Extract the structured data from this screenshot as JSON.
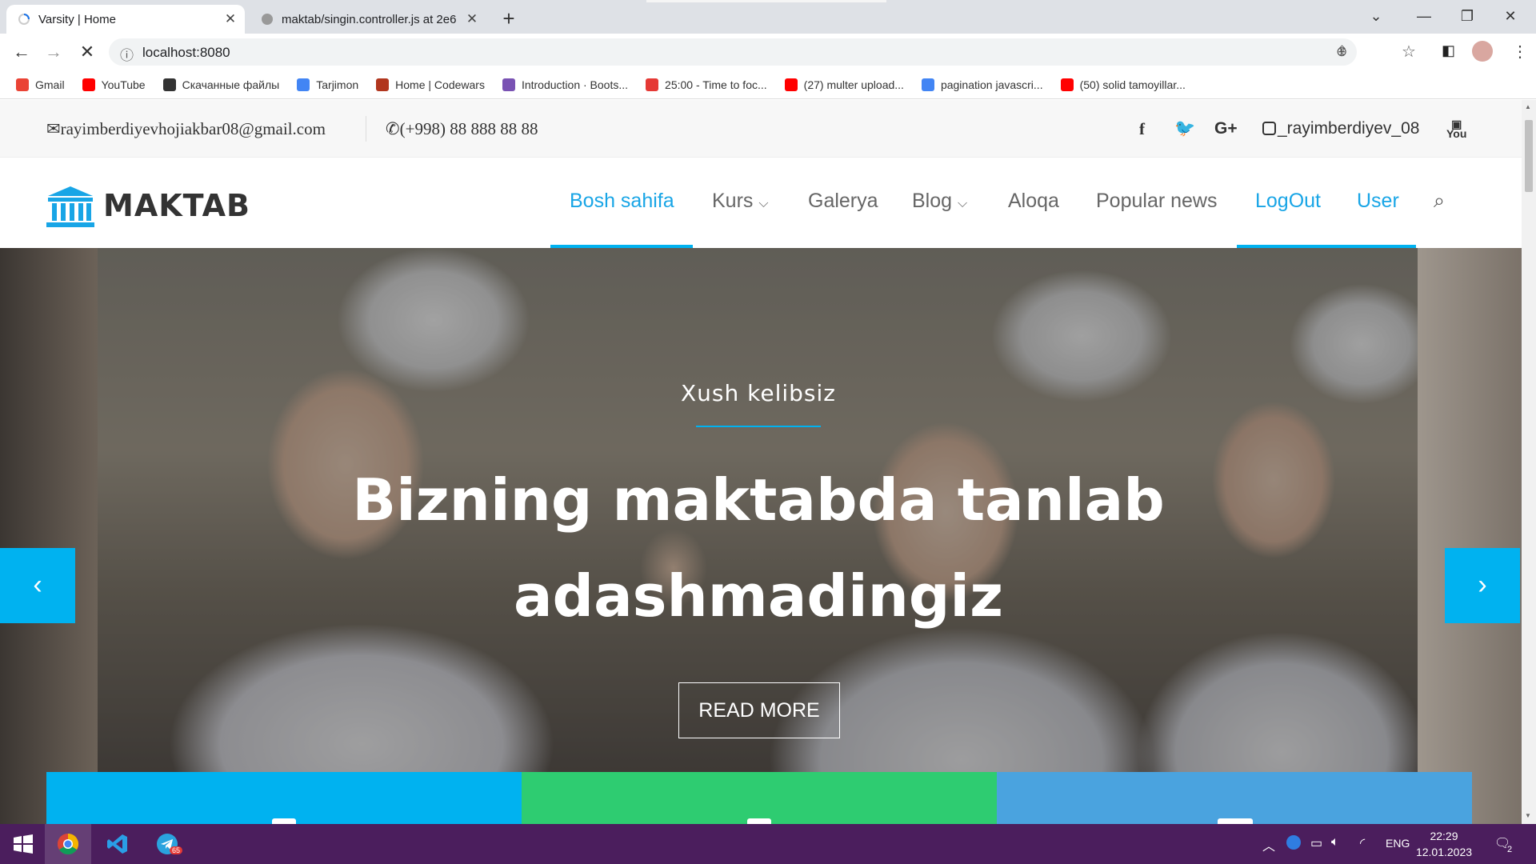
{
  "browser": {
    "tabs": [
      {
        "title": "Varsity | Home",
        "active": true
      },
      {
        "title": "maktab/singin.controller.js at 2e6",
        "active": false
      }
    ],
    "url": "localhost:8080",
    "bookmarks": [
      {
        "label": "Gmail",
        "icon": "gmail-icon",
        "color": "#ea4335"
      },
      {
        "label": "YouTube",
        "icon": "youtube-icon",
        "color": "#ff0000"
      },
      {
        "label": "Скачанные файлы",
        "icon": "download-icon",
        "color": "#333333"
      },
      {
        "label": "Tarjimon",
        "icon": "translate-icon",
        "color": "#4285f4"
      },
      {
        "label": "Home | Codewars",
        "icon": "codewars-icon",
        "color": "#b1361e"
      },
      {
        "label": "Introduction · Boots...",
        "icon": "bootstrap-icon",
        "color": "#7952b3"
      },
      {
        "label": "25:00 - Time to foc...",
        "icon": "pomodoro-icon",
        "color": "#e53935"
      },
      {
        "label": "(27) multer upload...",
        "icon": "youtube-icon",
        "color": "#ff0000"
      },
      {
        "label": "pagination javascri...",
        "icon": "google-icon",
        "color": "#4285f4"
      },
      {
        "label": "(50) solid tamoyillar...",
        "icon": "youtube-icon",
        "color": "#ff0000"
      }
    ]
  },
  "topbar": {
    "email": "rayimberdiyevhojiakbar08@gmail.com",
    "phone": "(+998) 88 888 88 88",
    "instagram": "_rayimberdiyev_08"
  },
  "navbar": {
    "logo": "MAKTAB",
    "items": [
      {
        "label": "Bosh sahifa",
        "active": true
      },
      {
        "label": "Kurs",
        "dropdown": true
      },
      {
        "label": "Galerya"
      },
      {
        "label": "Blog",
        "dropdown": true
      },
      {
        "label": "Aloqa"
      },
      {
        "label": "Popular news"
      },
      {
        "label": "LogOut",
        "active": true
      },
      {
        "label": "User",
        "active": true
      }
    ]
  },
  "hero": {
    "subtitle": "Xush kelibsiz",
    "title": "Bizning maktabda tanlab adashmadingiz",
    "button": "READ MORE"
  },
  "features": [
    {
      "color": "#00b2f0"
    },
    {
      "color": "#2ecc71"
    },
    {
      "color": "#4aa3df"
    }
  ],
  "taskbar": {
    "lang": "ENG",
    "time": "22:29",
    "date": "12.01.2023",
    "telegram_badge": "65",
    "notification_count": "2"
  },
  "colors": {
    "accent": "#00b2f0",
    "taskbar": "#4b1e5d"
  }
}
